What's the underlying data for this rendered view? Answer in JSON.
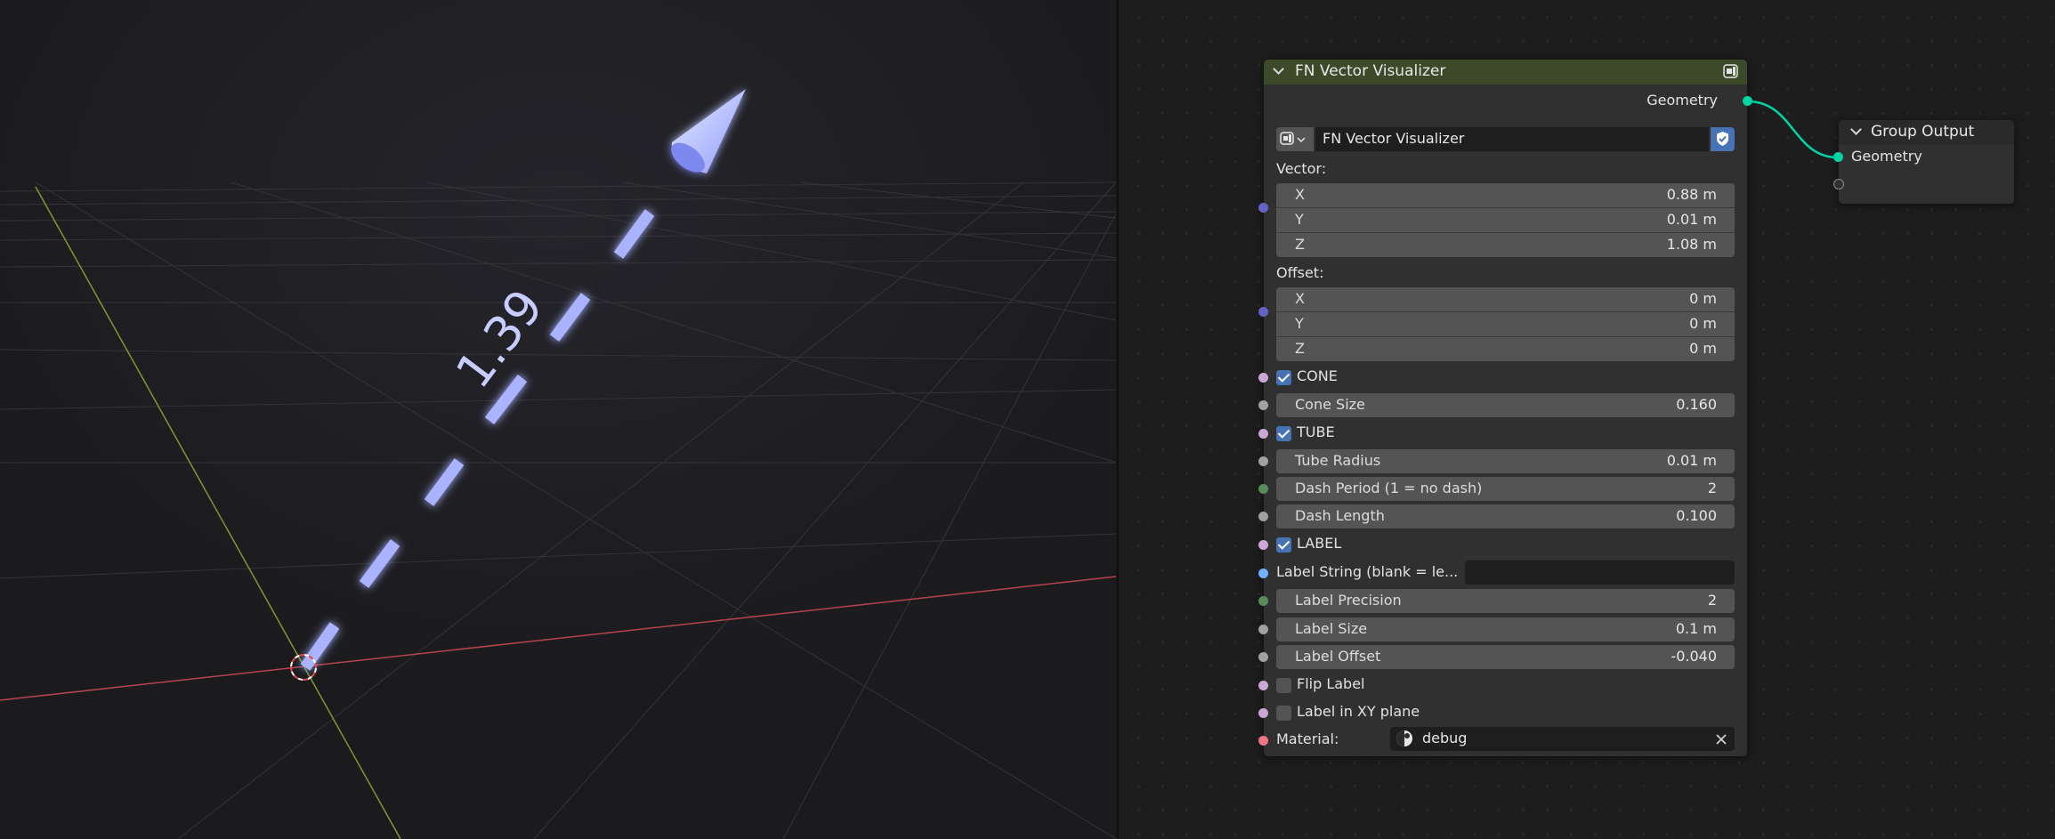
{
  "viewport": {
    "measurement_label": "1.39",
    "arrow_color": "#8a95ff",
    "grid_color": "#3a3a3a",
    "x_axis_color": "#b4444f",
    "y_axis_color": "#7b9a2e"
  },
  "vis_node": {
    "title": "FN Vector Visualizer",
    "header_color": "#3c4a29",
    "output_geometry": "Geometry",
    "group_name": "FN Vector Visualizer",
    "vector_label": "Vector:",
    "vector": [
      {
        "axis": "X",
        "value": "0.88 m"
      },
      {
        "axis": "Y",
        "value": "0.01 m"
      },
      {
        "axis": "Z",
        "value": "1.08 m"
      }
    ],
    "offset_label": "Offset:",
    "offset": [
      {
        "axis": "X",
        "value": "0 m"
      },
      {
        "axis": "Y",
        "value": "0 m"
      },
      {
        "axis": "Z",
        "value": "0 m"
      }
    ],
    "cone_label": "CONE",
    "cone_checked": true,
    "cone_size_label": "Cone Size",
    "cone_size_value": "0.160",
    "tube_label": "TUBE",
    "tube_checked": true,
    "tube_radius_label": "Tube Radius",
    "tube_radius_value": "0.01 m",
    "dash_period_label": "Dash Period (1 = no dash)",
    "dash_period_value": "2",
    "dash_length_label": "Dash Length",
    "dash_length_value": "0.100",
    "label_label": "LABEL",
    "label_checked": true,
    "label_string_label": "Label String (blank = le...",
    "label_string_value": "",
    "label_precision_label": "Label Precision",
    "label_precision_value": "2",
    "label_size_label": "Label Size",
    "label_size_value": "0.1 m",
    "label_offset_label": "Label Offset",
    "label_offset_value": "-0.040",
    "flip_label": "Flip Label",
    "flip_checked": false,
    "xy_plane_label": "Label in XY plane",
    "xy_checked": false,
    "material_label": "Material:",
    "material_value": "debug"
  },
  "out_node": {
    "title": "Group Output",
    "input_geometry": "Geometry"
  },
  "socket_colors": {
    "geometry": "#00d6a3",
    "vector": "#6363c7",
    "boolean": "#cca6d6",
    "float": "#a1a1a1",
    "integer": "#598c5c",
    "string": "#70b2ff",
    "material": "#eb7582",
    "empty": "#3c3c3c"
  }
}
